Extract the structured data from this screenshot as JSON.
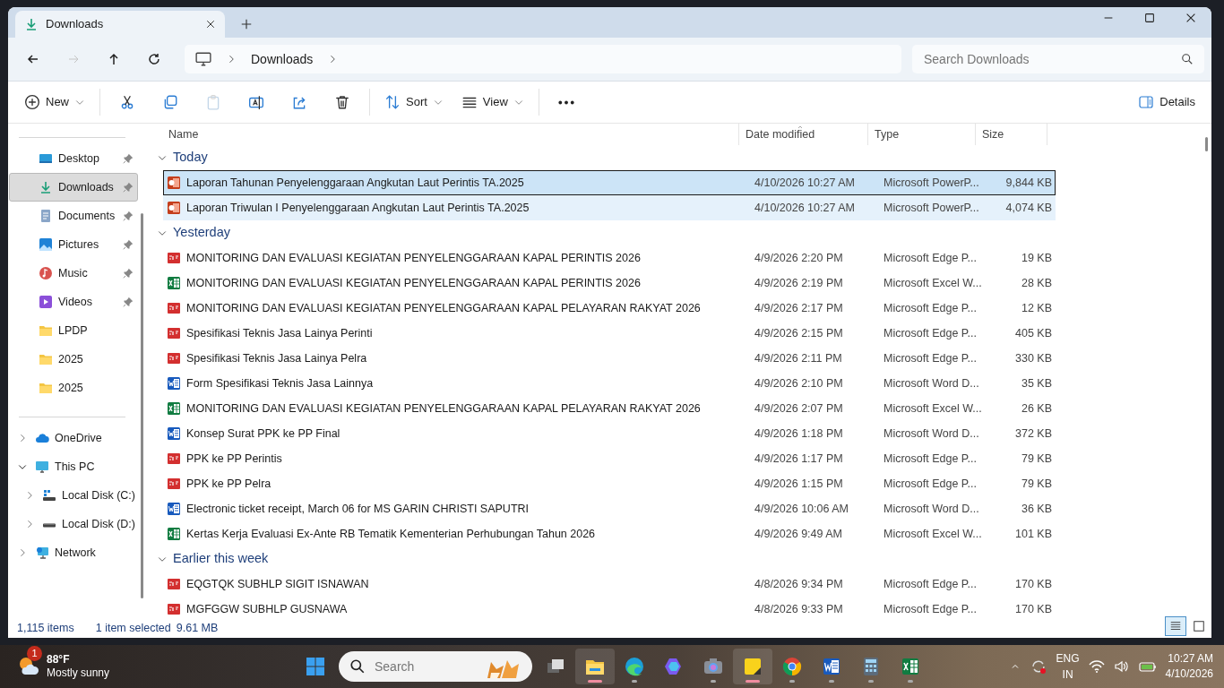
{
  "window": {
    "tab": {
      "title": "Downloads",
      "selected": true
    }
  },
  "nav": [
    {
      "kind": "back",
      "disabled": false
    },
    {
      "kind": "forward",
      "disabled": true
    },
    {
      "kind": "up",
      "disabled": false
    },
    {
      "kind": "refresh",
      "disabled": false
    }
  ],
  "breadcrumb": [
    "Downloads"
  ],
  "search": {
    "placeholder": "Search Downloads"
  },
  "toolbar": [
    {
      "kind": "new",
      "label": "New",
      "disabled": false
    },
    {
      "kind": "cut",
      "disabled": false
    },
    {
      "kind": "copy",
      "disabled": false
    },
    {
      "kind": "paste",
      "disabled": true
    },
    {
      "kind": "rename",
      "disabled": false
    },
    {
      "kind": "share",
      "disabled": false
    },
    {
      "kind": "delete",
      "disabled": false
    },
    {
      "kind": "sort",
      "label": "Sort",
      "disabled": false
    },
    {
      "kind": "view",
      "label": "View",
      "disabled": false
    },
    {
      "kind": "more",
      "disabled": false
    }
  ],
  "details_button": {
    "label": "Details"
  },
  "sidebar": {
    "quick_access": [
      {
        "label": "Desktop",
        "kind": "desktop",
        "pinned": true,
        "selected": false
      },
      {
        "label": "Downloads",
        "kind": "downloads",
        "pinned": true,
        "selected": true
      },
      {
        "label": "Documents",
        "kind": "documents",
        "pinned": true,
        "selected": false
      },
      {
        "label": "Pictures",
        "kind": "pictures",
        "pinned": true,
        "selected": false
      },
      {
        "label": "Music",
        "kind": "music",
        "pinned": true,
        "selected": false
      },
      {
        "label": "Videos",
        "kind": "videos",
        "pinned": true,
        "selected": false
      },
      {
        "label": "LPDP",
        "kind": "folder",
        "pinned": false,
        "selected": false
      },
      {
        "label": "2025",
        "kind": "folder",
        "pinned": false,
        "selected": false
      },
      {
        "label": "2025",
        "kind": "folder",
        "pinned": false,
        "selected": false
      }
    ],
    "tree": [
      {
        "label": "OneDrive",
        "kind": "cloud",
        "expanded": false
      },
      {
        "label": "This PC",
        "kind": "pc",
        "expanded": true,
        "children": [
          {
            "label": "Local Disk (C:)",
            "kind": "system-disk",
            "expanded": false
          },
          {
            "label": "Local Disk (D:)",
            "kind": "disk",
            "expanded": false
          }
        ]
      },
      {
        "label": "Network",
        "kind": "network",
        "expanded": false
      }
    ]
  },
  "table": {
    "columns": [
      {
        "label": "Name",
        "sorted": false
      },
      {
        "label": "Date modified",
        "sorted": true
      },
      {
        "label": "Type",
        "sorted": false
      },
      {
        "label": "Size",
        "sorted": false
      }
    ],
    "groups": [
      {
        "label": "Today",
        "expanded": true,
        "rows": [
          {
            "name": "Laporan Tahunan Penyelenggaraan Angkutan Laut Perintis TA.2025",
            "date": "4/10/2026 10:27 AM",
            "type": "Microsoft PowerP...",
            "size": "9,844 KB",
            "kind": "ppt",
            "selected": true,
            "hovered": false
          },
          {
            "name": "Laporan Triwulan I Penyelenggaraan Angkutan Laut Perintis TA.2025",
            "date": "4/10/2026 10:27 AM",
            "type": "Microsoft PowerP...",
            "size": "4,074 KB",
            "kind": "ppt",
            "selected": false,
            "hovered": true
          }
        ]
      },
      {
        "label": "Yesterday",
        "expanded": true,
        "rows": [
          {
            "name": "MONITORING DAN EVALUASI KEGIATAN PENYELENGGARAAN KAPAL PERINTIS 2026",
            "date": "4/9/2026 2:20 PM",
            "type": "Microsoft Edge P...",
            "size": "19 KB",
            "kind": "pdf",
            "selected": false,
            "hovered": false
          },
          {
            "name": "MONITORING DAN EVALUASI KEGIATAN PENYELENGGARAAN KAPAL PERINTIS 2026",
            "date": "4/9/2026 2:19 PM",
            "type": "Microsoft Excel W...",
            "size": "28 KB",
            "kind": "excel",
            "selected": false,
            "hovered": false
          },
          {
            "name": "MONITORING DAN EVALUASI KEGIATAN PENYELENGGARAAN KAPAL PELAYARAN RAKYAT 2026",
            "date": "4/9/2026 2:17 PM",
            "type": "Microsoft Edge P...",
            "size": "12 KB",
            "kind": "pdf",
            "selected": false,
            "hovered": false
          },
          {
            "name": "Spesifikasi Teknis Jasa Lainya Perinti",
            "date": "4/9/2026 2:15 PM",
            "type": "Microsoft Edge P...",
            "size": "405 KB",
            "kind": "pdf",
            "selected": false,
            "hovered": false
          },
          {
            "name": "Spesifikasi Teknis Jasa Lainya Pelra",
            "date": "4/9/2026 2:11 PM",
            "type": "Microsoft Edge P...",
            "size": "330 KB",
            "kind": "pdf",
            "selected": false,
            "hovered": false
          },
          {
            "name": "Form Spesifikasi Teknis Jasa Lainnya",
            "date": "4/9/2026 2:10 PM",
            "type": "Microsoft Word D...",
            "size": "35 KB",
            "kind": "word",
            "selected": false,
            "hovered": false
          },
          {
            "name": "MONITORING DAN EVALUASI KEGIATAN PENYELENGGARAAN KAPAL PELAYARAN RAKYAT 2026",
            "date": "4/9/2026 2:07 PM",
            "type": "Microsoft Excel W...",
            "size": "26 KB",
            "kind": "excel",
            "selected": false,
            "hovered": false
          },
          {
            "name": "Konsep Surat PPK ke PP Final",
            "date": "4/9/2026 1:18 PM",
            "type": "Microsoft Word D...",
            "size": "372 KB",
            "kind": "word",
            "selected": false,
            "hovered": false
          },
          {
            "name": "PPK ke PP Perintis",
            "date": "4/9/2026 1:17 PM",
            "type": "Microsoft Edge P...",
            "size": "79 KB",
            "kind": "pdf",
            "selected": false,
            "hovered": false
          },
          {
            "name": "PPK ke PP Pelra",
            "date": "4/9/2026 1:15 PM",
            "type": "Microsoft Edge P...",
            "size": "79 KB",
            "kind": "pdf",
            "selected": false,
            "hovered": false
          },
          {
            "name": "Electronic ticket receipt, March 06 for MS GARIN CHRISTI SAPUTRI",
            "date": "4/9/2026 10:06 AM",
            "type": "Microsoft Word D...",
            "size": "36 KB",
            "kind": "word",
            "selected": false,
            "hovered": false
          },
          {
            "name": "Kertas Kerja Evaluasi Ex-Ante RB Tematik Kementerian Perhubungan Tahun 2026",
            "date": "4/9/2026 9:49 AM",
            "type": "Microsoft Excel W...",
            "size": "101 KB",
            "kind": "excel",
            "selected": false,
            "hovered": false
          }
        ]
      },
      {
        "label": "Earlier this week",
        "expanded": true,
        "rows": [
          {
            "name": "EQGTQK SUBHLP SIGIT ISNAWAN",
            "date": "4/8/2026 9:34 PM",
            "type": "Microsoft Edge P...",
            "size": "170 KB",
            "kind": "pdf",
            "selected": false,
            "hovered": false
          },
          {
            "name": "MGFGGW SUBHLP GUSNAWA",
            "date": "4/8/2026 9:33 PM",
            "type": "Microsoft Edge P...",
            "size": "170 KB",
            "kind": "pdf",
            "selected": false,
            "hovered": false
          }
        ]
      }
    ]
  },
  "status_bar": {
    "item_count": "1,115 items",
    "selection": "1 item selected",
    "selection_size": "9.61 MB",
    "views": [
      {
        "kind": "details",
        "selected": true
      },
      {
        "kind": "tiles",
        "selected": false
      }
    ]
  },
  "taskbar": {
    "weather": {
      "badge": "1",
      "temperature": "88°F",
      "condition": "Mostly sunny"
    },
    "search": {
      "placeholder": "Search"
    },
    "apps": [
      {
        "kind": "start",
        "running": false,
        "active": false
      },
      {
        "kind": "search"
      },
      {
        "kind": "taskview",
        "running": false,
        "active": false
      },
      {
        "kind": "explorer",
        "running": true,
        "active": true
      },
      {
        "kind": "edge",
        "running": true,
        "active": false
      },
      {
        "kind": "copilot",
        "running": false,
        "active": false
      },
      {
        "kind": "camera",
        "running": true,
        "active": false
      },
      {
        "kind": "notes",
        "running": true,
        "active": true
      },
      {
        "kind": "chrome",
        "running": true,
        "active": false
      },
      {
        "kind": "word",
        "running": true,
        "active": false
      },
      {
        "kind": "calculator",
        "running": true,
        "active": false
      },
      {
        "kind": "excel",
        "running": true,
        "active": false
      }
    ],
    "tray": {
      "language": "ENG",
      "region": "IN",
      "time": "10:27 AM",
      "date": "4/10/2026"
    }
  }
}
